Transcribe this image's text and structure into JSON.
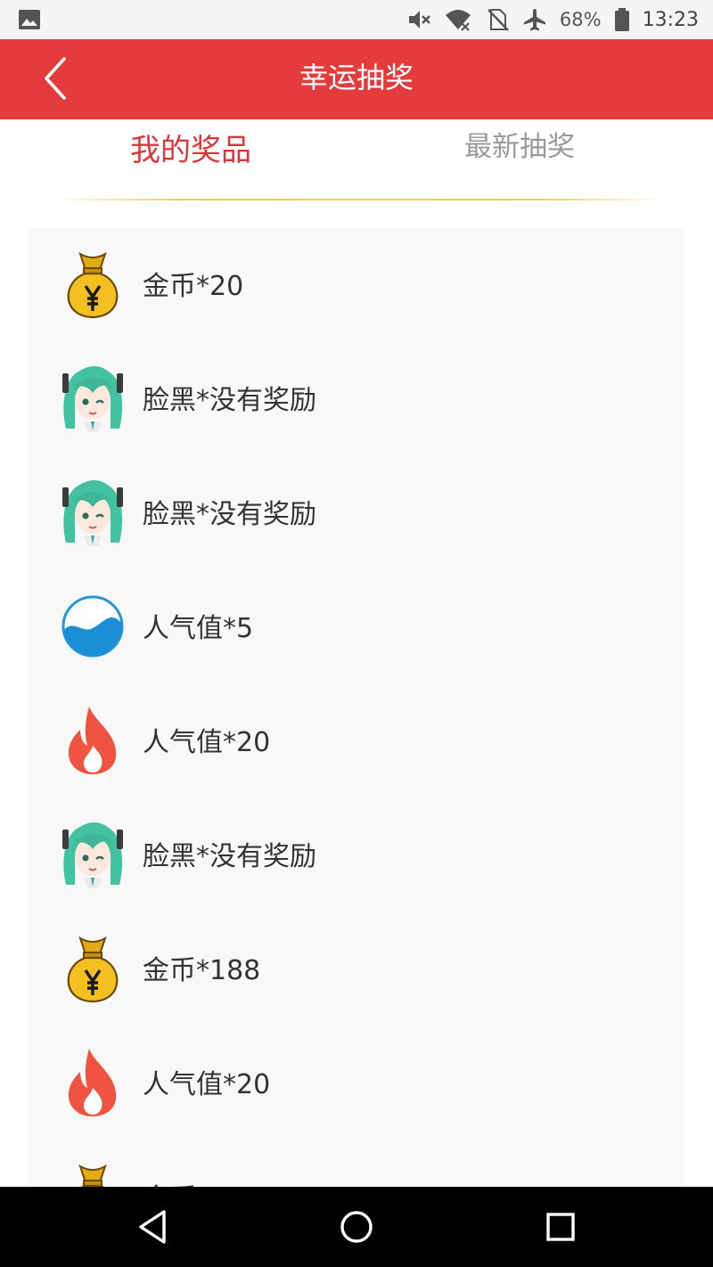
{
  "status_bar": {
    "battery_percent": "68%",
    "time": "13:23",
    "icons": [
      "image-icon",
      "mute-icon",
      "wifi-off-icon",
      "no-sim-icon",
      "airplane-icon",
      "battery-icon"
    ]
  },
  "app_bar": {
    "title": "幸运抽奖",
    "back_icon": "chevron-left-icon"
  },
  "tabs": [
    {
      "label": "我的奖品",
      "active": true
    },
    {
      "label": "最新抽奖",
      "active": false
    }
  ],
  "prizes": [
    {
      "label": "金币*20",
      "icon": "money-bag-icon"
    },
    {
      "label": "脸黑*没有奖励",
      "icon": "anime-avatar-icon"
    },
    {
      "label": "脸黑*没有奖励",
      "icon": "anime-avatar-icon"
    },
    {
      "label": "人气值*5",
      "icon": "blue-wave-icon"
    },
    {
      "label": "人气值*20",
      "icon": "flame-icon"
    },
    {
      "label": "脸黑*没有奖励",
      "icon": "anime-avatar-icon"
    },
    {
      "label": "金币*188",
      "icon": "money-bag-icon"
    },
    {
      "label": "人气值*20",
      "icon": "flame-icon"
    },
    {
      "label": "金币",
      "icon": "money-bag-icon"
    }
  ],
  "colors": {
    "app_bar": "#e53b3c",
    "active_tab": "#d8383a",
    "inactive_tab": "#9a9a9a",
    "divider": "#f2cc4f",
    "list_bg": "#f8f8f8"
  },
  "nav_bar": {
    "icons": [
      "back-triangle-icon",
      "home-circle-icon",
      "recents-square-icon"
    ]
  }
}
